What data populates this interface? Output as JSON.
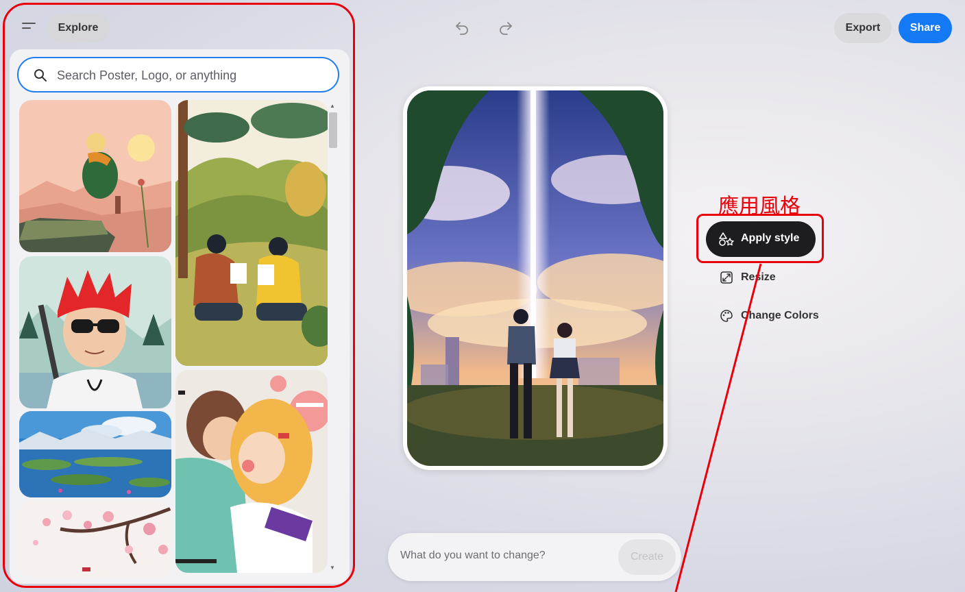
{
  "topbar": {
    "explore_label": "Explore",
    "export_label": "Export",
    "share_label": "Share",
    "icons": {
      "menu": "menu-icon",
      "undo": "undo-icon",
      "redo": "redo-icon"
    }
  },
  "left_panel": {
    "search": {
      "placeholder": "Search Poster, Logo, or anything",
      "value": "",
      "icon": "search-icon"
    },
    "thumbnails": [
      "thumbnail-sitting-figure-sunset",
      "thumbnail-couple-reading-hills",
      "thumbnail-red-hair-sunglasses-boy",
      "thumbnail-lake-mountain-landscape",
      "thumbnail-hugging-couple",
      "thumbnail-cherry-blossom"
    ]
  },
  "annotation": {
    "label": "應用風格",
    "color": "#e8000b"
  },
  "tools": {
    "apply_style": {
      "label": "Apply style",
      "icon": "shapes-icon"
    },
    "resize": {
      "label": "Resize",
      "icon": "resize-icon"
    },
    "change_colors": {
      "label": "Change Colors",
      "icon": "palette-icon"
    }
  },
  "prompt": {
    "placeholder": "What do you want to change?",
    "create_label": "Create"
  },
  "colors": {
    "accent_blue": "#1479f5",
    "dark_button": "#1d1d20",
    "annotation_red": "#e8000b"
  }
}
